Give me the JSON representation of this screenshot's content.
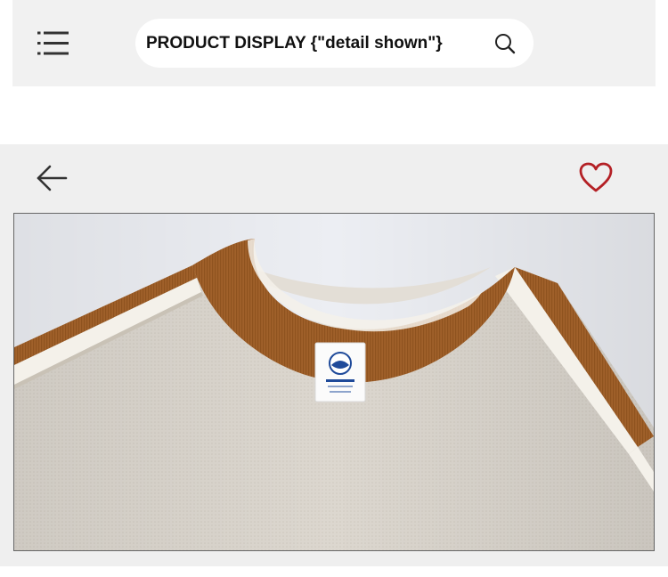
{
  "header": {
    "menu_icon": "hamburger-menu-icon",
    "search": {
      "value": "PRODUCT DISPLAY {\"detail shown\"}",
      "icon": "search-icon"
    }
  },
  "viewer": {
    "back_icon": "back-arrow-icon",
    "favorite_icon": "heart-icon",
    "favorite_color": "#b42025"
  },
  "product_image": {
    "colors": {
      "body": "#dcd7cf",
      "trim": "#a0602a",
      "stripe": "#f4f1ea",
      "background": "#eceef3"
    }
  }
}
